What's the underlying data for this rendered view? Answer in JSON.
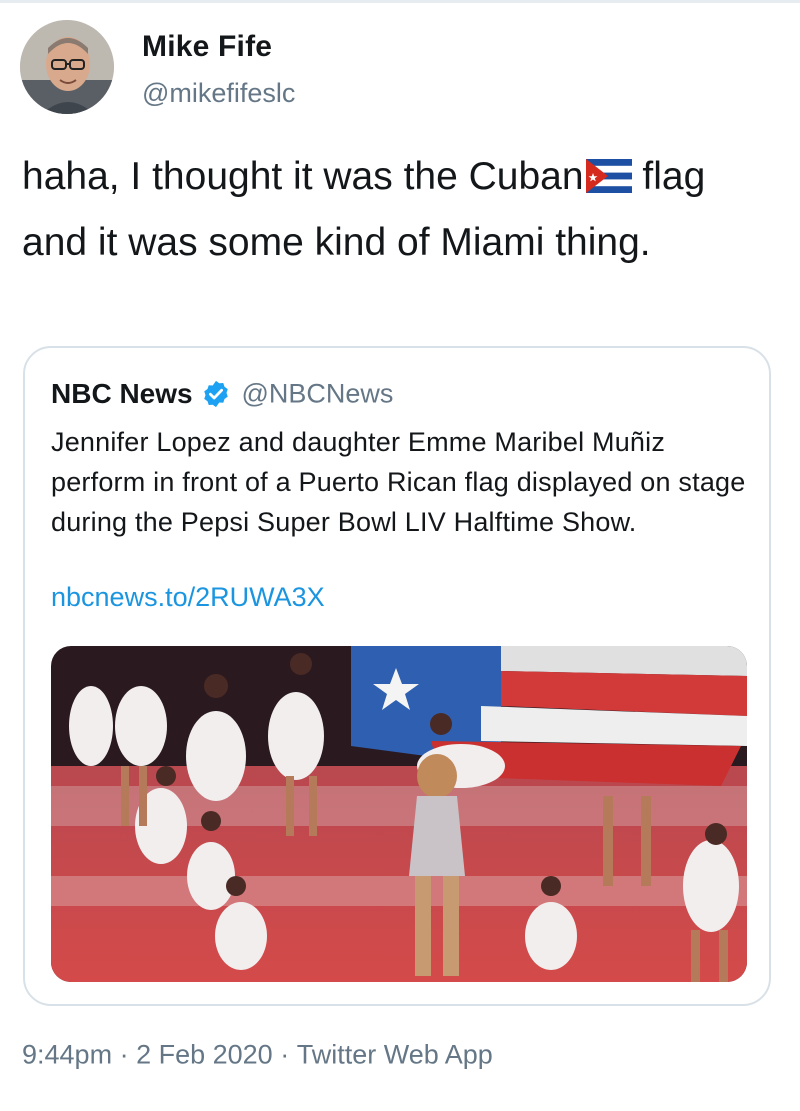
{
  "tweet": {
    "author_name": "Mike Fife",
    "author_handle": "@mikefifeslc",
    "text": "haha, I thought it was the Cuban",
    "text_emoji": "cuba-flag-emoji",
    "text_continued": " flag and it was some kind of Miami thing."
  },
  "quoted_tweet": {
    "author_name": "NBC News",
    "verified_icon": "verified-badge-icon",
    "author_handle": "@NBCNews",
    "text": "Jennifer Lopez and daughter Emme Maribel Muñiz perform in front of a Puerto Rican flag displayed on stage during the Pepsi Super Bowl LIV Halftime Show.",
    "link": "nbcnews.to/2RUWA3X"
  },
  "meta": {
    "time": "9:44pm",
    "separator": "·",
    "date": "2 Feb 2020",
    "source": "Twitter Web App"
  },
  "colors": {
    "text": "#14171a",
    "secondary": "#657786",
    "link": "#1b95e0",
    "border": "#d9e1e8"
  }
}
